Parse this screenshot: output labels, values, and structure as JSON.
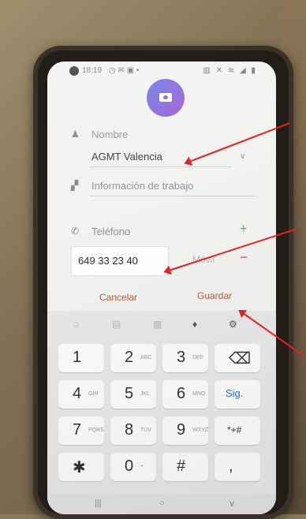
{
  "status_bar": {
    "time": "18:19",
    "left_icons": "◷ ✉ ▣ •",
    "right_icons": "▥ ✕ ≋ ◢ ▮"
  },
  "contact": {
    "name_label": "Nombre",
    "name_value": "AGMT Valencia",
    "work_label": "Información de trabajo",
    "phone_label": "Teléfono",
    "phone_value": "649 33 23 40",
    "phone_type": "Móvil"
  },
  "actions": {
    "cancel": "Cancelar",
    "save": "Guardar"
  },
  "keyboard": {
    "keys": [
      {
        "n": "1",
        "s": ""
      },
      {
        "n": "2",
        "s": "ABC"
      },
      {
        "n": "3",
        "s": "DEF"
      },
      {
        "n": "⌫",
        "s": ""
      },
      {
        "n": "4",
        "s": "GHI"
      },
      {
        "n": "5",
        "s": "JKL"
      },
      {
        "n": "6",
        "s": "MNO"
      },
      {
        "n": "Sig.",
        "s": ""
      },
      {
        "n": "7",
        "s": "PQRS"
      },
      {
        "n": "8",
        "s": "TUV"
      },
      {
        "n": "9",
        "s": "WXYZ"
      },
      {
        "n": "*+#",
        "s": ""
      },
      {
        "n": "✱",
        "s": ""
      },
      {
        "n": "0",
        "s": "+"
      },
      {
        "n": "#",
        "s": ""
      },
      {
        "n": ",",
        "s": ""
      }
    ]
  },
  "nav": {
    "recent": "|||",
    "home": "○",
    "back": "∨"
  },
  "colors": {
    "accent": "#b9583a",
    "arrow": "#e5221f",
    "add": "#57b45a",
    "remove": "#d55b5b",
    "next": "#2a6ee0"
  }
}
